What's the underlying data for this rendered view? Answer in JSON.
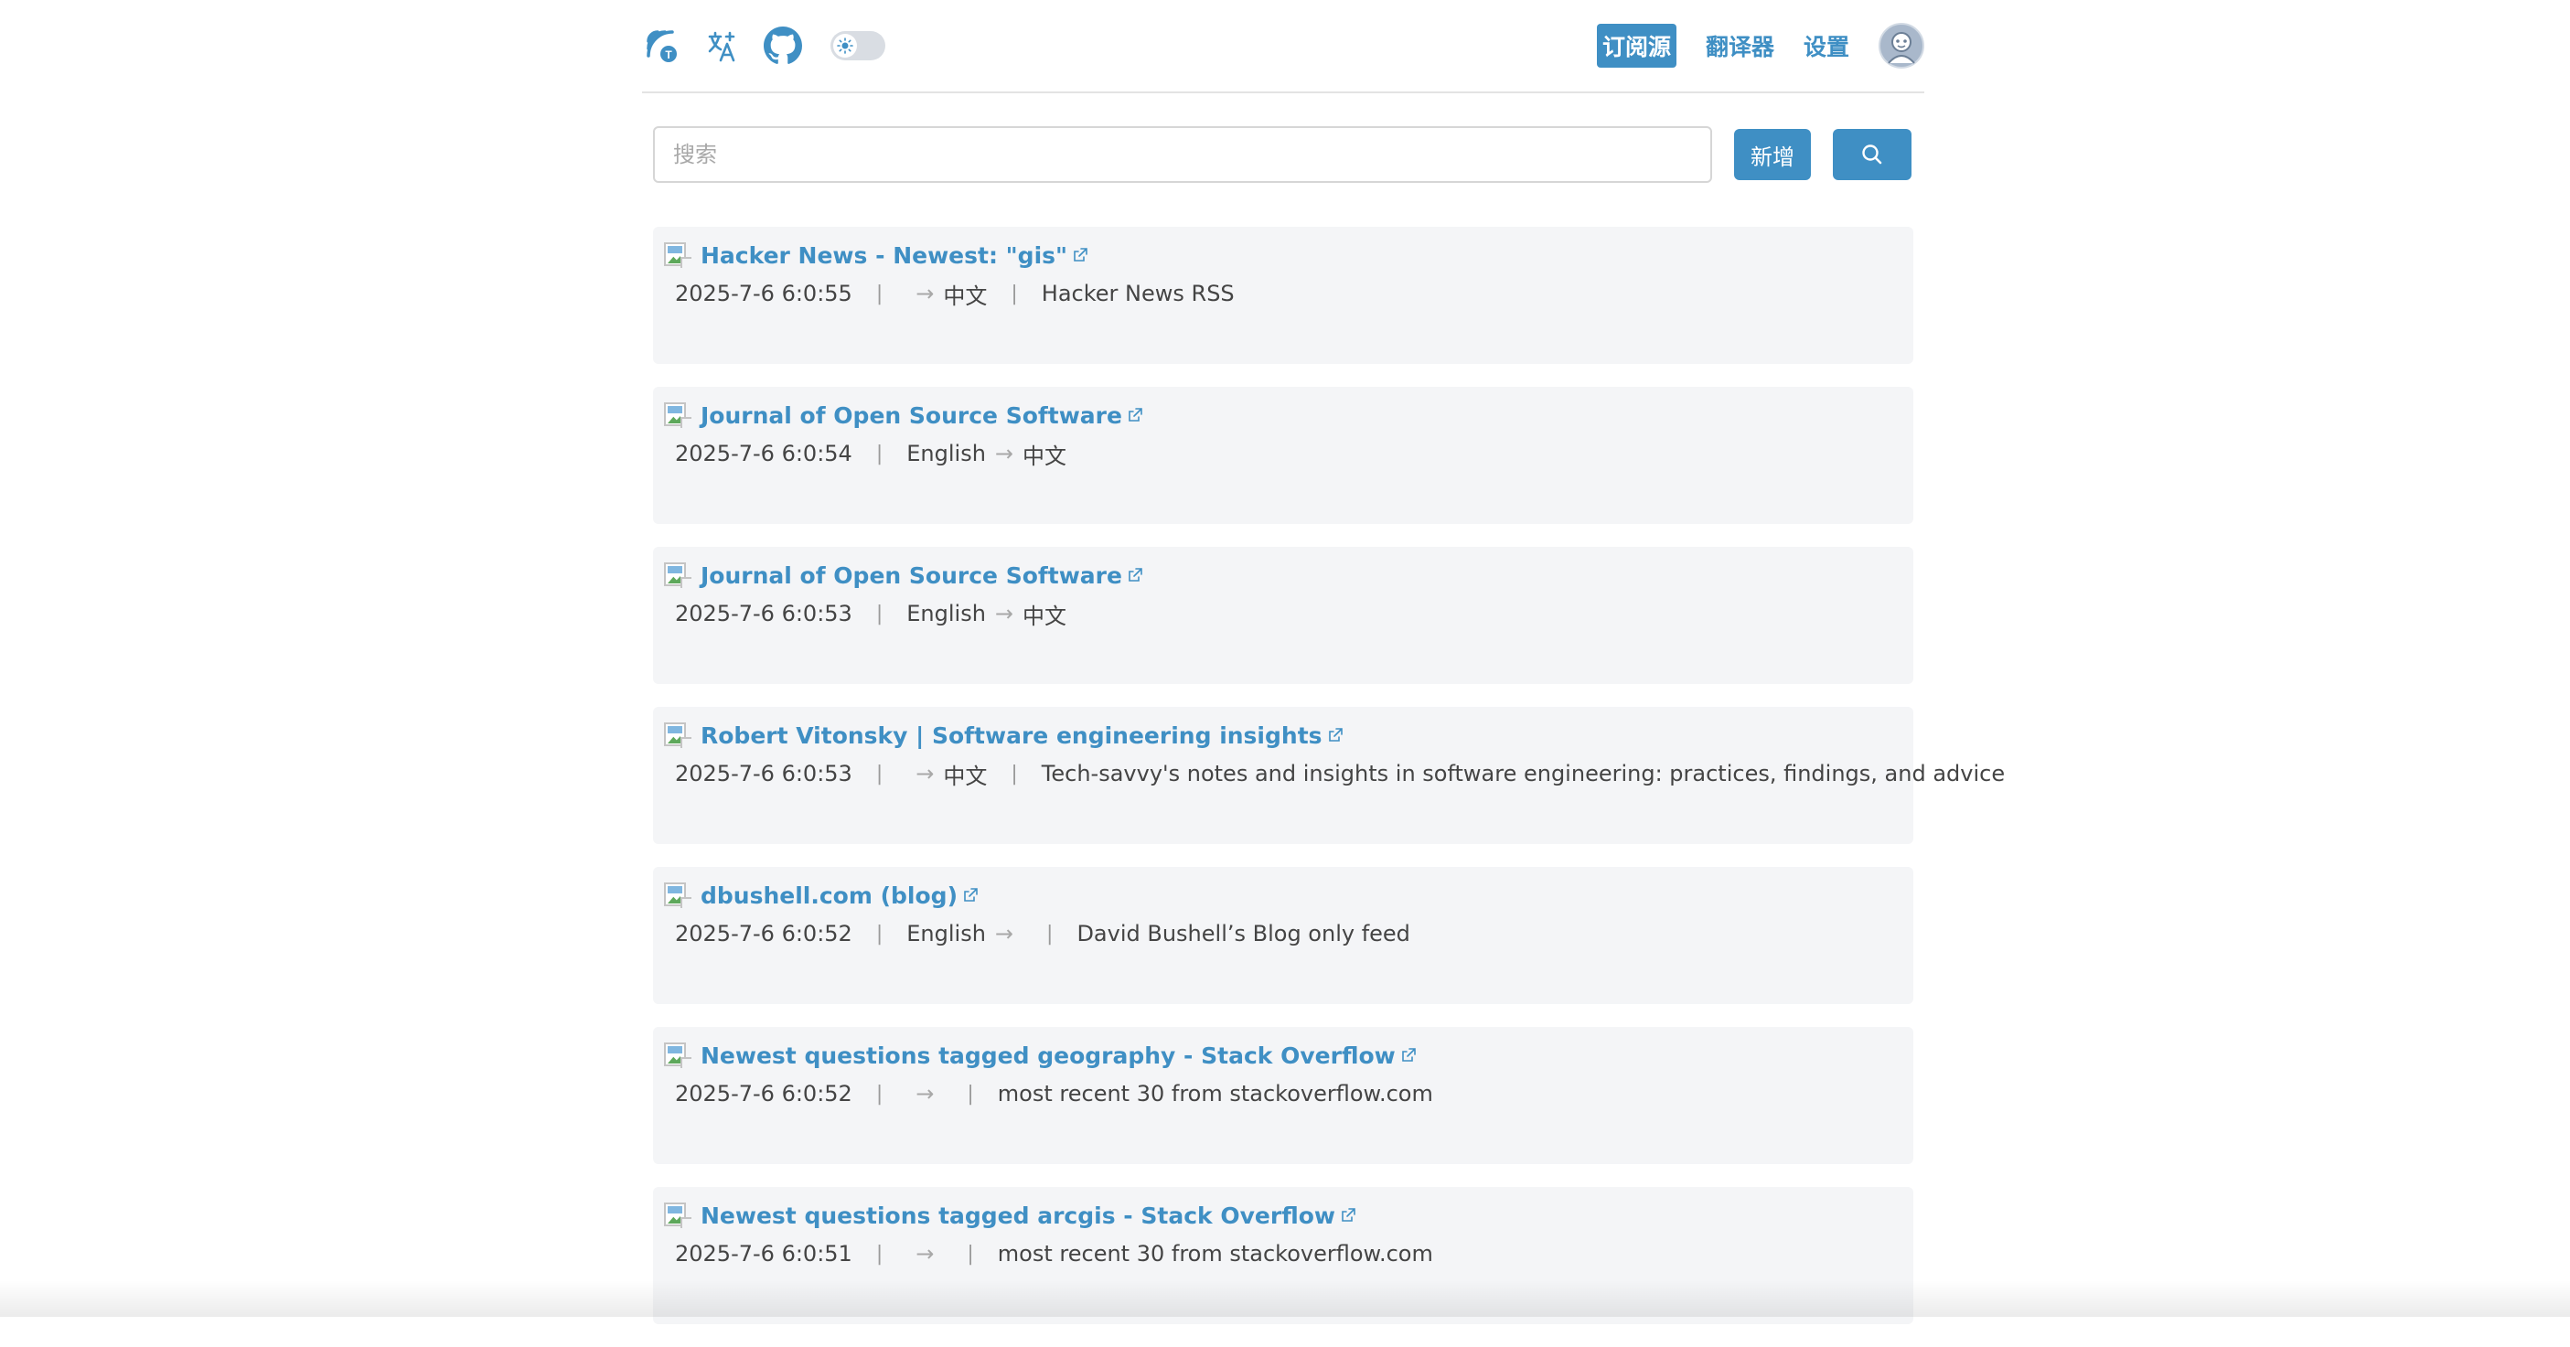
{
  "header": {
    "icons": [
      "rss-translate-icon",
      "translate-icon",
      "github-icon",
      "theme-toggle"
    ],
    "nav": [
      {
        "label": "订阅源",
        "active": true
      },
      {
        "label": "翻译器",
        "active": false
      },
      {
        "label": "设置",
        "active": false
      }
    ],
    "accent_color": "#3f8fc4"
  },
  "search": {
    "placeholder": "搜索",
    "value": "",
    "add_label": "新增"
  },
  "feeds": [
    {
      "title": "Hacker News - Newest: \"gis\"",
      "time": "2025-7-6 6:0:55",
      "from_lang": "",
      "arrow": "→",
      "to_lang": "中文",
      "desc": "Hacker News RSS"
    },
    {
      "title": "Journal of Open Source Software",
      "time": "2025-7-6 6:0:54",
      "from_lang": "English",
      "arrow": "→",
      "to_lang": "中文",
      "desc": ""
    },
    {
      "title": "Journal of Open Source Software",
      "time": "2025-7-6 6:0:53",
      "from_lang": "English",
      "arrow": "→",
      "to_lang": "中文",
      "desc": ""
    },
    {
      "title": "Robert Vitonsky | Software engineering insights",
      "time": "2025-7-6 6:0:53",
      "from_lang": "",
      "arrow": "→",
      "to_lang": "中文",
      "desc": "Tech-savvy's notes and insights in software engineering: practices, findings, and advice"
    },
    {
      "title": "dbushell.com (blog)",
      "time": "2025-7-6 6:0:52",
      "from_lang": "English",
      "arrow": "→",
      "to_lang": "",
      "desc": "David Bushell’s Blog only feed"
    },
    {
      "title": "Newest questions tagged geography - Stack Overflow",
      "time": "2025-7-6 6:0:52",
      "from_lang": "",
      "arrow": "→",
      "to_lang": "",
      "desc": "most recent 30 from stackoverflow.com"
    },
    {
      "title": "Newest questions tagged arcgis - Stack Overflow",
      "time": "2025-7-6 6:0:51",
      "from_lang": "",
      "arrow": "→",
      "to_lang": "",
      "desc": "most recent 30 from stackoverflow.com"
    }
  ]
}
